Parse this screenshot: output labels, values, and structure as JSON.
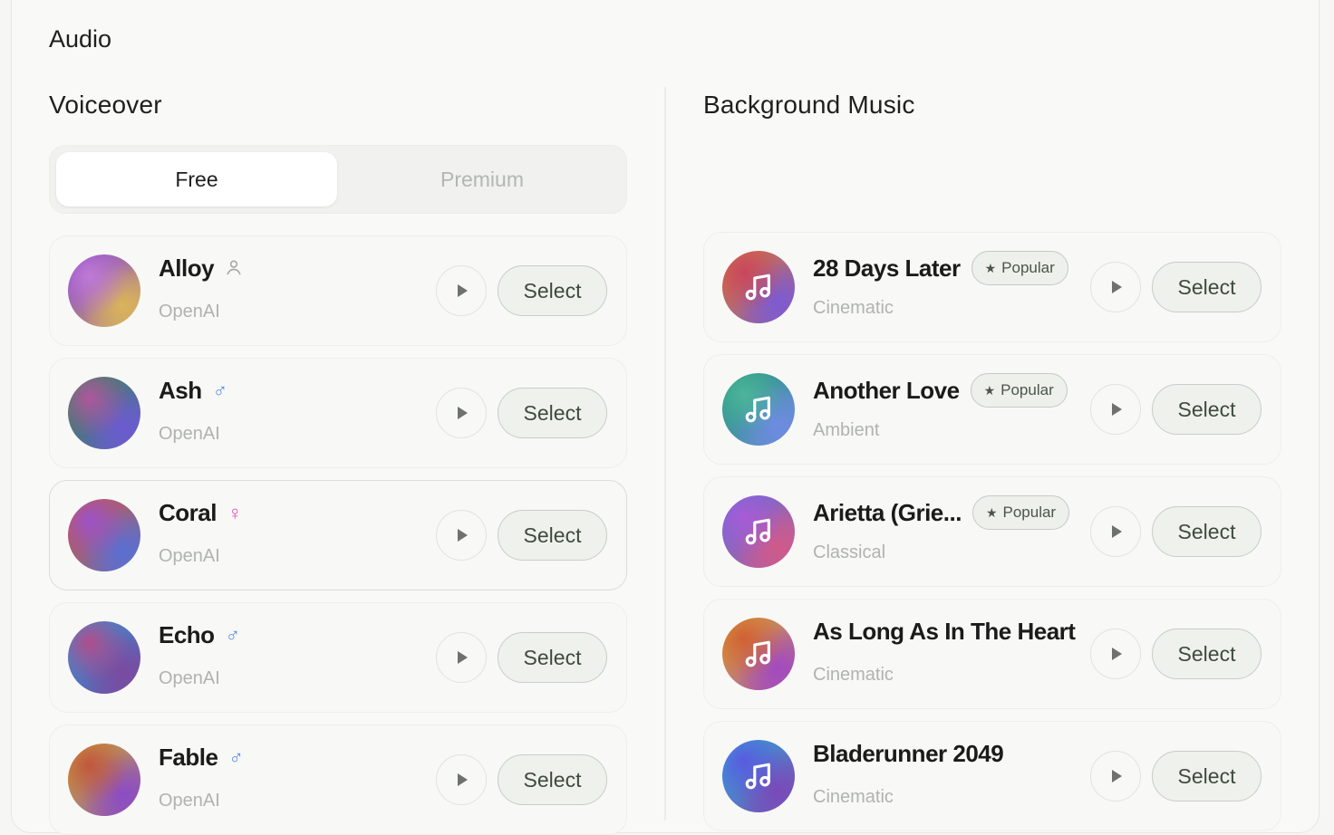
{
  "audio_title": "Audio",
  "voiceover": {
    "title": "Voiceover",
    "tabs": [
      {
        "label": "Free",
        "active": true
      },
      {
        "label": "Premium",
        "active": false
      }
    ],
    "voices": [
      {
        "name": "Alloy",
        "provider": "OpenAI",
        "gender": "neutral",
        "gender_glyph": "👤",
        "icon": "person-icon",
        "select_label": "Select",
        "gradient": [
          "#7b3ad6",
          "#c07ad6",
          "#d9b45a"
        ],
        "highlight": false
      },
      {
        "name": "Ash",
        "provider": "OpenAI",
        "gender": "male",
        "gender_glyph": "♂",
        "icon": "male-icon",
        "select_label": "Select",
        "gradient": [
          "#2f8a4a",
          "#b0569e",
          "#6b5bd0"
        ],
        "highlight": false
      },
      {
        "name": "Coral",
        "provider": "OpenAI",
        "gender": "female",
        "gender_glyph": "♀",
        "icon": "female-icon",
        "select_label": "Select",
        "gradient": [
          "#d9562a",
          "#9b52c9",
          "#5a6fd1"
        ],
        "highlight": true
      },
      {
        "name": "Echo",
        "provider": "OpenAI",
        "gender": "male",
        "gender_glyph": "♂",
        "icon": "male-icon",
        "select_label": "Select",
        "gradient": [
          "#2c9ad9",
          "#b04d8c",
          "#7a4aa0"
        ],
        "highlight": false
      },
      {
        "name": "Fable",
        "provider": "OpenAI",
        "gender": "male",
        "gender_glyph": "♂",
        "icon": "male-icon",
        "select_label": "Select",
        "gradient": [
          "#d4b224",
          "#c0563f",
          "#8b4cc4"
        ],
        "highlight": false
      }
    ]
  },
  "background_music": {
    "title": "Background Music",
    "tracks": [
      {
        "name": "28 Days Later",
        "genre": "Cinematic",
        "popular": true,
        "badge_label": "Popular",
        "select_label": "Select",
        "gradient": [
          "#e07a28",
          "#c9465e",
          "#7d5ad0"
        ]
      },
      {
        "name": "Another Love",
        "genre": "Ambient",
        "popular": true,
        "badge_label": "Popular",
        "select_label": "Select",
        "gradient": [
          "#1f9a72",
          "#4cb59a",
          "#6e8be0"
        ]
      },
      {
        "name": "Arietta (Grie...",
        "genre": "Classical",
        "popular": true,
        "badge_label": "Popular",
        "select_label": "Select",
        "gradient": [
          "#5a6ee0",
          "#a85bd6",
          "#d05a8a"
        ]
      },
      {
        "name": "As Long As In The Heart",
        "genre": "Cinematic",
        "popular": false,
        "badge_label": "",
        "select_label": "Select",
        "gradient": [
          "#e0b020",
          "#d06036",
          "#a24ac0"
        ]
      },
      {
        "name": "Bladerunner 2049",
        "genre": "Cinematic",
        "popular": false,
        "badge_label": "",
        "select_label": "Select",
        "gradient": [
          "#2bb0d6",
          "#5a5ae0",
          "#7a4ab8"
        ]
      }
    ]
  },
  "colors": {
    "accent_select_border": "#c9ccc8",
    "male_icon": "#5b8fe6",
    "female_icon": "#e04fb5"
  }
}
